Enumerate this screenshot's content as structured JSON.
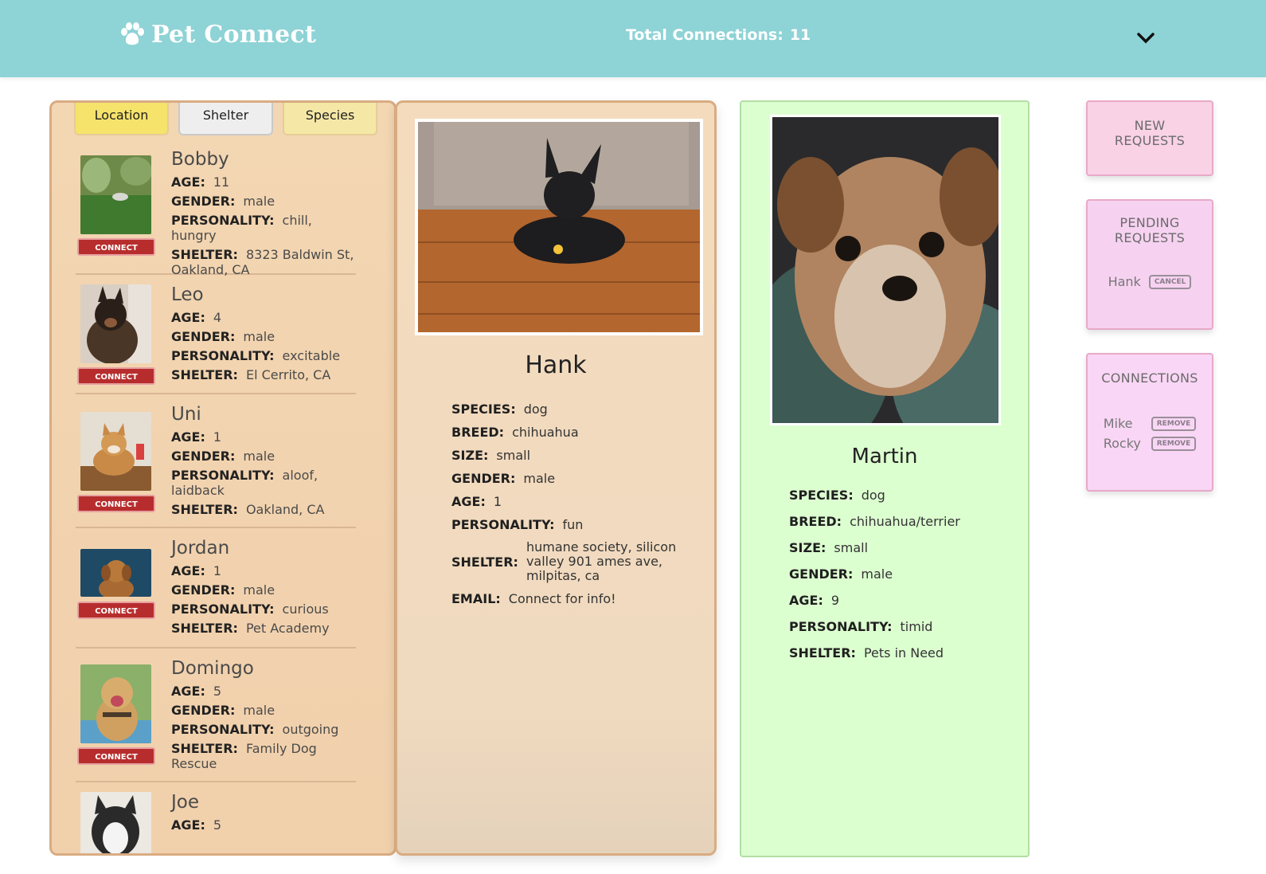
{
  "header": {
    "app_name": "Pet Connect",
    "logo_icon": "paw-icon",
    "total_label": "Total Connections:",
    "total_count": "11",
    "menu_icon": "chevron-down-icon"
  },
  "filters": {
    "tabs": [
      {
        "label": "Location"
      },
      {
        "label": "Shelter"
      },
      {
        "label": "Species"
      }
    ]
  },
  "labels": {
    "age": "AGE:",
    "gender": "GENDER:",
    "personality": "PERSONALITY:",
    "shelter": "SHELTER:",
    "species": "SPECIES:",
    "breed": "BREED:",
    "size": "SIZE:",
    "email": "EMAIL:",
    "connect": "CONNECT"
  },
  "pets": [
    {
      "name": "Bobby",
      "age": "11",
      "gender": "male",
      "personality": "chill, hungry",
      "shelter": "8323 Baldwin St, Oakland, CA"
    },
    {
      "name": "Leo",
      "age": "4",
      "gender": "male",
      "personality": "excitable",
      "shelter": "El Cerrito, CA"
    },
    {
      "name": "Uni",
      "age": "1",
      "gender": "male",
      "personality": "aloof, laidback",
      "shelter": "Oakland, CA"
    },
    {
      "name": "Jordan",
      "age": "1",
      "gender": "male",
      "personality": "curious",
      "shelter": "Pet Academy"
    },
    {
      "name": "Domingo",
      "age": "5",
      "gender": "male",
      "personality": "outgoing",
      "shelter": "Family Dog Rescue"
    },
    {
      "name": "Joe",
      "age": "5"
    }
  ],
  "selected": {
    "name": "Hank",
    "species": "dog",
    "breed": "chihuahua",
    "size": "small",
    "gender": "male",
    "age": "1",
    "personality": "fun",
    "shelter": "humane society, silicon valley 901 ames ave, milpitas, ca",
    "email": "Connect for info!"
  },
  "profile": {
    "name": "Martin",
    "species": "dog",
    "breed": "chihuahua/terrier",
    "size": "small",
    "gender": "male",
    "age": "9",
    "personality": "timid",
    "shelter": "Pets in Need"
  },
  "side": {
    "new_requests_title": "NEW REQUESTS",
    "pending_title": "PENDING REQUESTS",
    "pending": [
      {
        "name": "Hank",
        "action": "CANCEL"
      }
    ],
    "connections_title": "CONNECTIONS",
    "connections": [
      {
        "name": "Mike",
        "action": "REMOVE"
      },
      {
        "name": "Rocky",
        "action": "REMOVE"
      }
    ]
  },
  "colors": {
    "header_bg": "#8ed3d6",
    "panel_tan": "#f3d6b2",
    "profile_green": "#dcffd0",
    "connect_red": "#b72d2d",
    "tab_yellow": "#f5e36b",
    "side_pink": "#f9d2e6"
  }
}
